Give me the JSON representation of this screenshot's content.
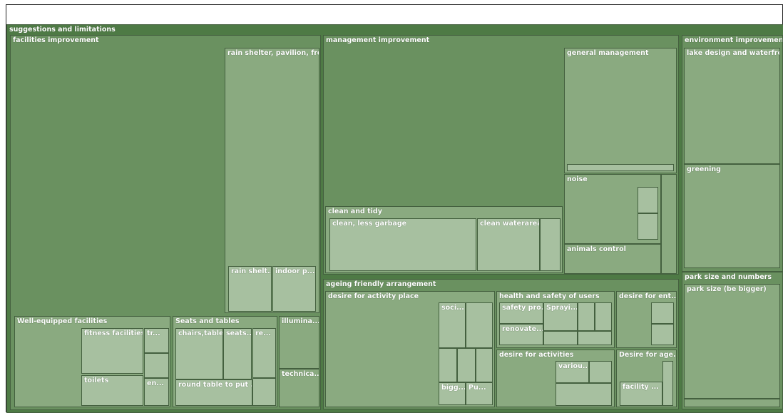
{
  "chart_data": {
    "type": "treemap",
    "title": "",
    "root": "suggestions and limitations",
    "groups": [
      {
        "key": "facilities",
        "label": "facilities improvement",
        "children": [
          {
            "key": "rain",
            "label": "rain shelter, pavilion, fro...",
            "children": [
              {
                "key": "rainShelt",
                "label": "rain shelt..."
              },
              {
                "key": "indoor",
                "label": "indoor p..."
              }
            ]
          },
          {
            "key": "wellEquipped",
            "label": "Well-equipped facilities",
            "children": [
              {
                "key": "fitness",
                "label": "fitness facilities..."
              },
              {
                "key": "tr",
                "label": "tr..."
              },
              {
                "key": "toilets",
                "label": "toilets"
              },
              {
                "key": "en",
                "label": "en..."
              },
              {
                "key": "weSmall",
                "label": ""
              }
            ]
          },
          {
            "key": "seats",
            "label": "Seats and tables",
            "children": [
              {
                "key": "chairs",
                "label": "chairs,table ,"
              },
              {
                "key": "seatsSub",
                "label": "seats..."
              },
              {
                "key": "re",
                "label": "re..."
              },
              {
                "key": "roundTable",
                "label": "round table to put ..."
              },
              {
                "key": "seatsSmall",
                "label": ""
              }
            ]
          },
          {
            "key": "illumina",
            "label": "illumina...",
            "children": []
          },
          {
            "key": "technica",
            "label": "technica...",
            "children": []
          }
        ]
      },
      {
        "key": "management",
        "label": "management improvement",
        "children": [
          {
            "key": "general",
            "label": "general management",
            "children": [
              {
                "key": "generalSub",
                "label": ""
              }
            ]
          },
          {
            "key": "noise",
            "label": "noise",
            "children": [
              {
                "key": "noiseA",
                "label": ""
              },
              {
                "key": "noiseB",
                "label": ""
              }
            ]
          },
          {
            "key": "animals",
            "label": "animals control",
            "children": []
          },
          {
            "key": "mgmtSmall",
            "label": "",
            "children": []
          },
          {
            "key": "clean",
            "label": "clean and tidy",
            "children": [
              {
                "key": "cleanLess",
                "label": "clean, less garbage"
              },
              {
                "key": "cleanWater",
                "label": "clean waterarea"
              },
              {
                "key": "cleanSmall",
                "label": ""
              }
            ]
          }
        ]
      },
      {
        "key": "ageing",
        "label": "ageing friendly arrangement",
        "children": [
          {
            "key": "desirePlace",
            "label": "desire for activity place",
            "children": [
              {
                "key": "soci",
                "label": "soci..."
              },
              {
                "key": "daA",
                "label": ""
              },
              {
                "key": "daB",
                "label": ""
              },
              {
                "key": "daC",
                "label": ""
              },
              {
                "key": "daD",
                "label": ""
              },
              {
                "key": "bigg",
                "label": "bigg..."
              },
              {
                "key": "pu",
                "label": "Pu..."
              }
            ]
          },
          {
            "key": "health",
            "label": "health and safety of users",
            "children": [
              {
                "key": "safety",
                "label": "safety pro..."
              },
              {
                "key": "sprayi",
                "label": "Sprayi..."
              },
              {
                "key": "hsA",
                "label": ""
              },
              {
                "key": "hsB",
                "label": ""
              },
              {
                "key": "renovate",
                "label": "renovate..."
              },
              {
                "key": "hsC",
                "label": ""
              },
              {
                "key": "hsD",
                "label": ""
              }
            ]
          },
          {
            "key": "desireEnt",
            "label": "desire for ent...",
            "children": [
              {
                "key": "entA",
                "label": ""
              },
              {
                "key": "entB",
                "label": ""
              }
            ]
          },
          {
            "key": "desireAct",
            "label": "desire for activities",
            "children": [
              {
                "key": "variou",
                "label": "variou..."
              },
              {
                "key": "actA",
                "label": ""
              },
              {
                "key": "actB",
                "label": ""
              }
            ]
          },
          {
            "key": "desireAge",
            "label": "Desire for age...",
            "children": [
              {
                "key": "facility",
                "label": "facility ..."
              },
              {
                "key": "ageA",
                "label": ""
              }
            ]
          }
        ]
      },
      {
        "key": "environment",
        "label": "environment improvement",
        "children": [
          {
            "key": "lake",
            "label": "lake design and waterfront",
            "children": []
          },
          {
            "key": "greening",
            "label": "greening",
            "children": []
          }
        ]
      },
      {
        "key": "park",
        "label": "park size and numbers",
        "children": [
          {
            "key": "parkSize",
            "label": "park size (be bigger)",
            "children": []
          },
          {
            "key": "parkSmall",
            "label": "",
            "children": []
          }
        ]
      }
    ]
  }
}
